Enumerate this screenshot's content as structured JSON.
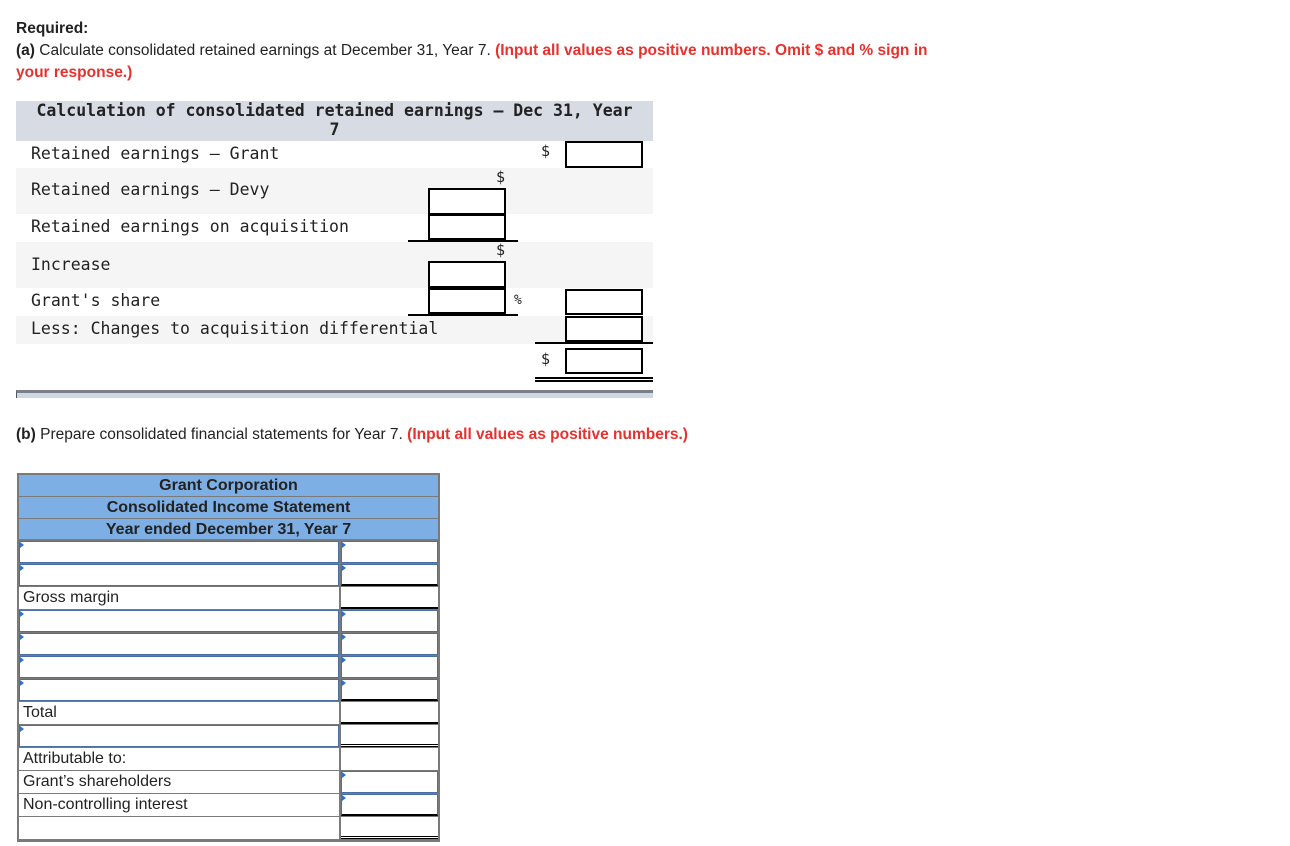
{
  "required": {
    "heading": "Required:",
    "part_a_label": "(a)",
    "part_a_text": " Calculate consolidated retained earnings at December 31, Year 7. ",
    "part_a_note": "(Input all values as positive numbers. Omit $ and % sign in your response.)"
  },
  "calc_table": {
    "title": "Calculation of consolidated retained earnings – Dec 31, Year 7",
    "rows": [
      {
        "label": "Retained earnings – Grant",
        "value": ""
      },
      {
        "label": "Retained earnings – Devy",
        "value": ""
      },
      {
        "label": "Retained earnings on acquisition",
        "value": ""
      },
      {
        "label": "Increase",
        "value": ""
      },
      {
        "label": "Grant's share",
        "value": "",
        "share_value": ""
      },
      {
        "label": "Less: Changes to acquisition differential",
        "value": ""
      }
    ],
    "total_value": "",
    "dollar_sign": "$",
    "percent_sign": "%"
  },
  "part_b": {
    "label": "(b)",
    "text": " Prepare consolidated financial statements for Year 7. ",
    "note": "(Input all values as positive numbers.)"
  },
  "income_statement": {
    "company": "Grant Corporation",
    "title": "Consolidated Income Statement",
    "period": "Year ended December 31, Year 7",
    "rows": [
      {
        "label": "",
        "value": ""
      },
      {
        "label": "",
        "value": ""
      },
      {
        "label": "Gross margin",
        "value": ""
      },
      {
        "label": "",
        "value": ""
      },
      {
        "label": "",
        "value": ""
      },
      {
        "label": "",
        "value": ""
      },
      {
        "label": "",
        "value": ""
      },
      {
        "label": "Total",
        "value": ""
      },
      {
        "label": "",
        "value": ""
      },
      {
        "label": "Attributable to:",
        "value": ""
      },
      {
        "label": "Grant’s shareholders",
        "value": ""
      },
      {
        "label": "Non-controlling interest",
        "value": ""
      },
      {
        "label": "",
        "value": ""
      }
    ]
  }
}
